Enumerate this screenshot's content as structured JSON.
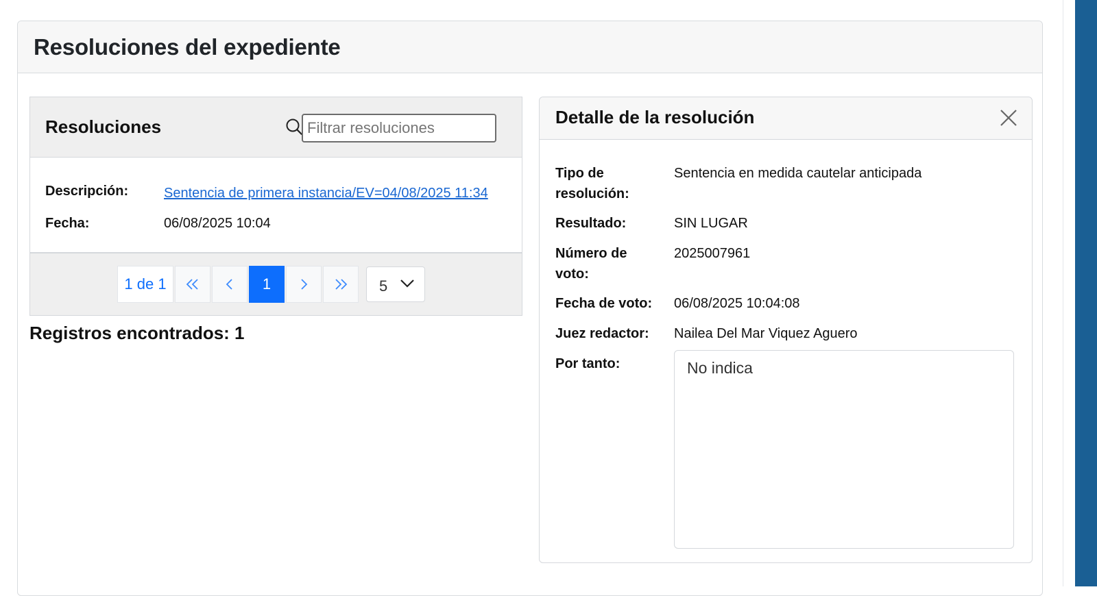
{
  "main": {
    "title": "Resoluciones del expediente"
  },
  "list": {
    "title": "Resoluciones",
    "search_placeholder": "Filtrar resoluciones",
    "records": [
      {
        "descripcion_label": "Descripción:",
        "descripcion_value": "Sentencia de primera instancia/EV=04/08/2025 11:34",
        "fecha_label": "Fecha:",
        "fecha_value": "06/08/2025 10:04"
      }
    ],
    "pager": {
      "count_label": "1 de 1",
      "first_label": "«",
      "prev_label": "‹",
      "current_page": "1",
      "next_label": "›",
      "last_label": "»",
      "page_size": "5"
    },
    "records_found": "Registros encontrados: 1"
  },
  "detail": {
    "title": "Detalle de la resolución",
    "fields": [
      {
        "label": "Tipo de resolución:",
        "value": "Sentencia en medida cautelar anticipada"
      },
      {
        "label": "Resultado:",
        "value": "SIN LUGAR"
      },
      {
        "label": "Número de voto:",
        "value": "2025007961"
      },
      {
        "label": "Fecha de voto:",
        "value": "06/08/2025 10:04:08"
      },
      {
        "label": "Juez redactor:",
        "value": "Nailea Del Mar Viquez Aguero"
      }
    ],
    "por_tanto_label": "Por tanto:",
    "por_tanto_value": "No indica"
  },
  "colors": {
    "accent": "#0d6efd",
    "link": "#1967d2",
    "right_strip": "#1a5f94"
  },
  "icons": [
    "search-icon",
    "close-icon",
    "chevron-down-icon",
    "double-chevron-left-icon",
    "chevron-left-icon",
    "chevron-right-icon",
    "double-chevron-right-icon"
  ]
}
